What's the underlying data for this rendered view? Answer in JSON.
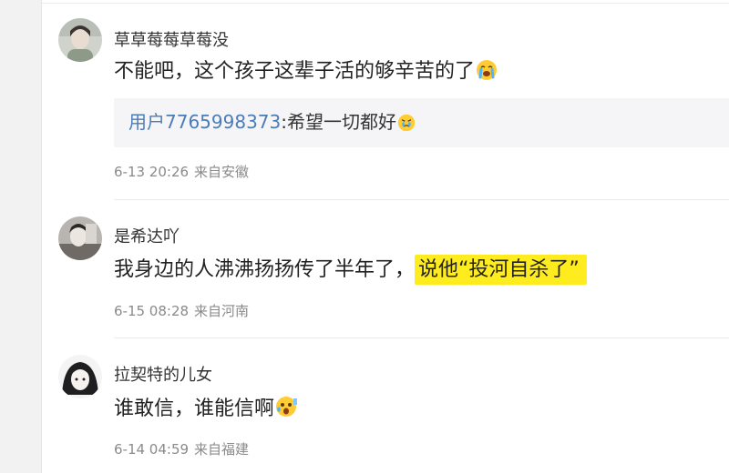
{
  "comments": [
    {
      "username": "草草莓莓草莓没",
      "text": "不能吧，这个孩子这辈子活的够辛苦的了",
      "emoji": "crying-emoji",
      "reply": {
        "user": "用户7765998373",
        "separator": ":",
        "text": "希望一切都好",
        "emoji": "tearful-emoji"
      },
      "time": "6-13 20:26",
      "location": "来自安徽"
    },
    {
      "username": "是希达吖",
      "text_before": "我身边的人沸沸扬扬传了半年了，",
      "text_highlight": "说他“投河自杀了”",
      "highlight_color": "#ffec1f",
      "time": "6-15 08:28",
      "location": "来自河南"
    },
    {
      "username": "拉契特的儿女",
      "text": "谁敢信，谁能信啊",
      "emoji": "shocked-emoji",
      "time": "6-14 04:59",
      "location": "来自福建"
    }
  ],
  "colors": {
    "reply_user": "#4a7cb8",
    "meta": "#8a8a8a",
    "background": "#f2f2f2"
  }
}
